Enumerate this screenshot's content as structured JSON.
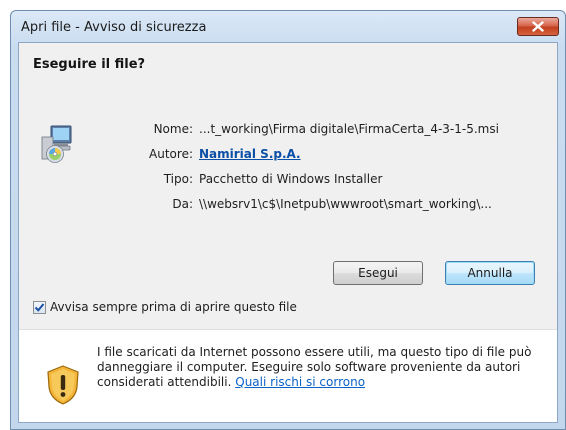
{
  "window": {
    "title": "Apri file - Avviso di sicurezza"
  },
  "dialog": {
    "heading": "Eseguire il file?",
    "fields": [
      {
        "label": "Nome:",
        "value": "...t_working\\Firma digitale\\FirmaCerta_4-3-1-5.msi"
      },
      {
        "label": "Autore:",
        "value": "Namirial S.p.A."
      },
      {
        "label": "Tipo:",
        "value": "Pacchetto di Windows Installer"
      },
      {
        "label": "Da:",
        "value": "\\\\websrv1\\c$\\Inetpub\\wwwroot\\smart_working\\..."
      }
    ],
    "buttons": {
      "run": "Esegui",
      "cancel": "Annulla"
    },
    "checkbox": {
      "label": "Avvisa sempre prima di aprire questo file",
      "checked": true
    },
    "warning": {
      "text": "I file scaricati da Internet possono essere utili, ma questo tipo di file può danneggiare il computer. Eseguire solo software proveniente da autori considerati attendibili.",
      "link": "Quali rischi si corrono"
    }
  },
  "colors": {
    "link": "#0a4fa6",
    "close_button": "#c2401f",
    "frame": "#c7dcf1"
  },
  "icons": {
    "file": "windows-installer-icon",
    "warning": "security-shield-icon",
    "close": "close-icon",
    "check": "check-icon"
  }
}
